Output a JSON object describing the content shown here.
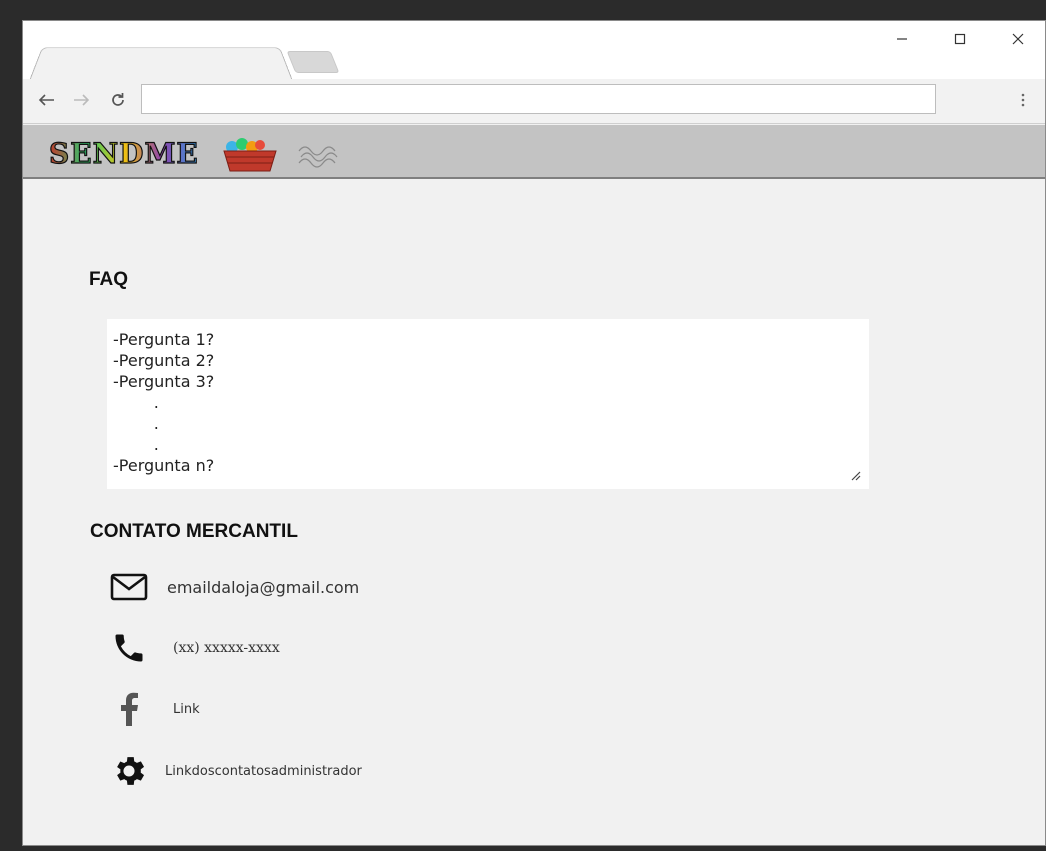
{
  "browser": {
    "address_value": "",
    "address_placeholder": ""
  },
  "site": {
    "logo_text": "SENDME"
  },
  "faq": {
    "heading": "FAQ",
    "lines": [
      "-Pergunta 1?",
      "-Pergunta 2?",
      "-Pergunta 3?",
      "        .",
      "        .",
      "        .",
      "-Pergunta n?"
    ]
  },
  "contact": {
    "heading": "CONTATO MERCANTIL",
    "email": "emaildaloja@gmail.com",
    "phone": "(xx) xxxxx-xxxx",
    "facebook_link": "Link",
    "admin_link": "Linkdoscontatosadministrador"
  },
  "icons": {
    "email": "mail-icon",
    "phone": "phone-icon",
    "facebook": "facebook-icon",
    "admin": "gear-icon"
  }
}
